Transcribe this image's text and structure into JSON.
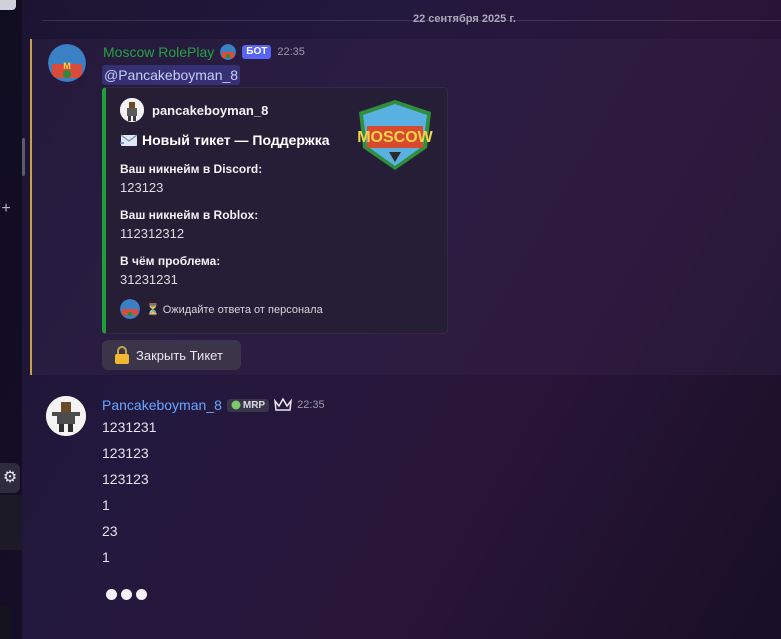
{
  "divider": {
    "date": "22 сентября 2025 г."
  },
  "message_bot": {
    "author": "Moscow RolePlay",
    "tag": "БОТ",
    "time": "22:35",
    "mention": "@Pancakeboyman_8",
    "embed": {
      "author_name": "pancakeboyman_8",
      "title": "Новый тикет — Поддержка",
      "fields": [
        {
          "name": "Ваш никнейм в Discord:",
          "value": "123123"
        },
        {
          "name": "Ваш никнейм в Roblox:",
          "value": "112312312"
        },
        {
          "name": "В чём проблема:",
          "value": "31231231"
        }
      ],
      "footer": "⏳ Ожидайте ответа от персонала",
      "accent_color": "#1f9e39"
    },
    "button": {
      "label": "Закрыть Тикет",
      "icon": "lock-icon"
    }
  },
  "message_user": {
    "author": "Pancakeboyman_8",
    "tag": "MRP",
    "time": "22:35",
    "lines": [
      "1231231",
      "123123",
      "123123",
      "1",
      "23",
      "1"
    ]
  },
  "colors": {
    "bot_name": "#25a243",
    "bot_tag": "#5865f2",
    "user_name": "#6aa6ff",
    "highlight_bar": "#c8a24a"
  }
}
